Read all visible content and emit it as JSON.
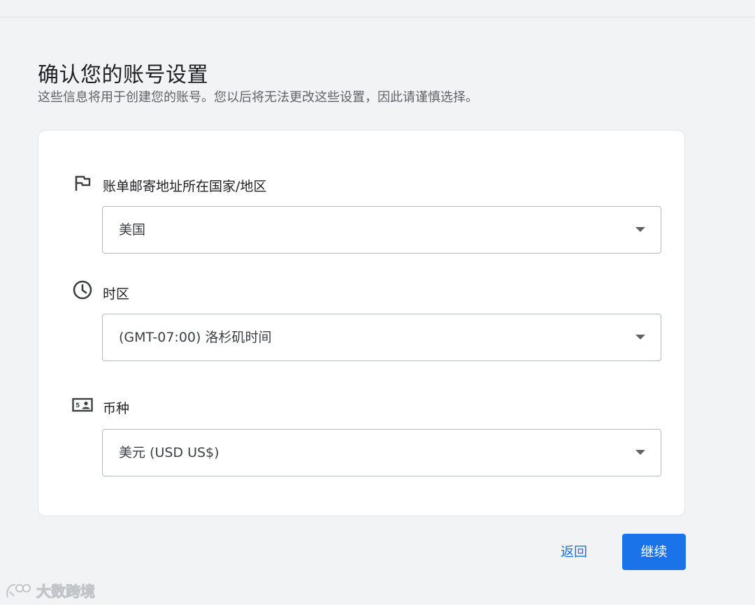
{
  "header": {
    "title": "确认您的账号设置",
    "subtitle": "这些信息将用于创建您的账号。您以后将无法更改这些设置，因此请谨慎选择。"
  },
  "form": {
    "country": {
      "icon": "flag-icon",
      "label": "账单邮寄地址所在国家/地区",
      "value": "美国"
    },
    "timezone": {
      "icon": "clock-icon",
      "label": "时区",
      "value": "(GMT-07:00) 洛杉矶时间"
    },
    "currency": {
      "icon": "currency-icon",
      "label": "币种",
      "value": "美元 (USD US$)"
    }
  },
  "actions": {
    "back_label": "返回",
    "continue_label": "继续"
  },
  "watermark": {
    "text": "大数跨境"
  },
  "colors": {
    "accent": "#1a73e8",
    "background": "#f1f3f4",
    "card": "#ffffff",
    "text": "#202124",
    "secondary_text": "#5f6368"
  }
}
